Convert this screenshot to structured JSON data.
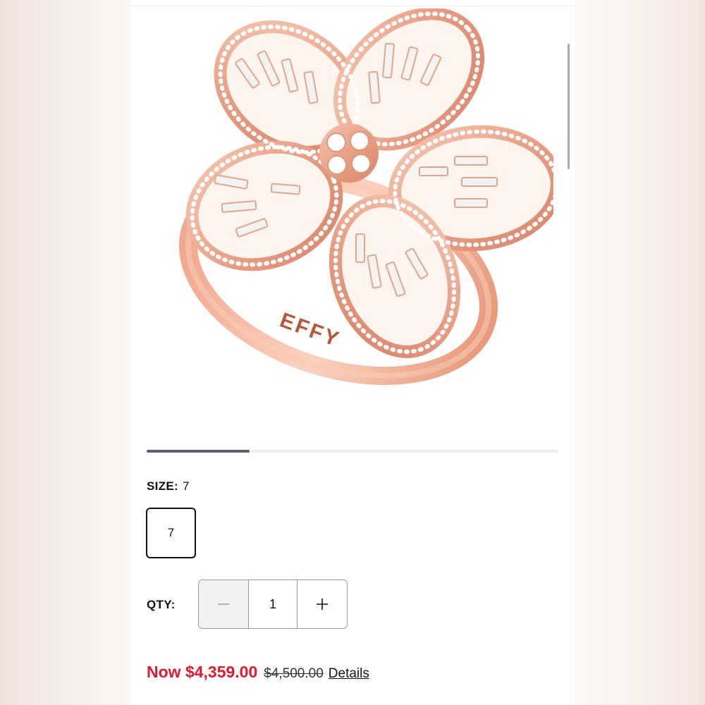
{
  "product": {
    "image_alt": "Rose gold diamond flower ring",
    "engraving": "EFFY"
  },
  "gallery": {
    "progress": 0.25
  },
  "size": {
    "label": "SIZE:",
    "selected": "7",
    "options": [
      "7"
    ]
  },
  "quantity": {
    "label": "QTY:",
    "value": "1",
    "decrement_icon": "minus-icon",
    "increment_icon": "plus-icon"
  },
  "price": {
    "now": "Now $4,359.00",
    "was": "$4,500.00",
    "details_link": "Details"
  },
  "colors": {
    "sale_red": "#e11930",
    "rose_gold": "#e8a88a",
    "text": "#111111"
  }
}
